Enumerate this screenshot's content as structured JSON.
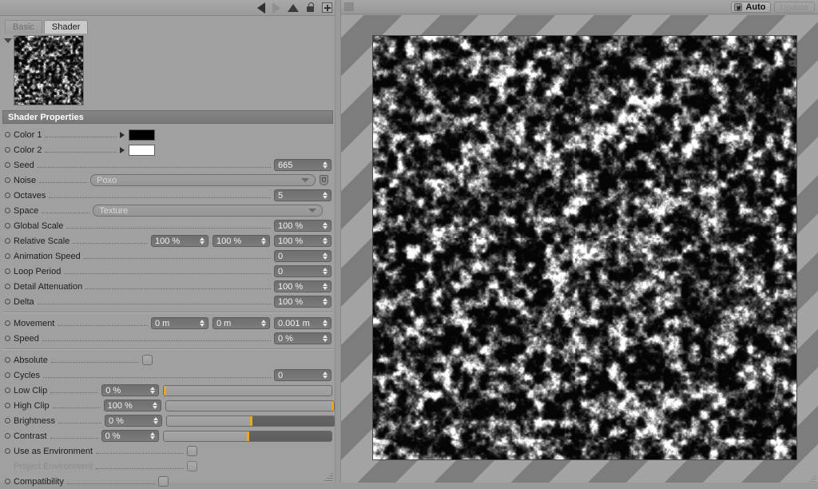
{
  "left_panel": {
    "toolbar": {
      "back_icon": "triangle-left-icon",
      "forward_icon": "triangle-right-icon",
      "up_icon": "triangle-up-icon",
      "lock_icon": "lock-open-icon",
      "add_icon": "plus-icon"
    },
    "tabs": [
      {
        "label": "Basic",
        "active": false
      },
      {
        "label": "Shader",
        "active": true
      }
    ],
    "preview": {
      "disclosure_icon": "triangle-down-icon",
      "thumbnail_name": "shader-preview-thumbnail"
    },
    "section_title": "Shader Properties",
    "groups": [
      {
        "rows": [
          {
            "label": "Color 1",
            "type": "color",
            "value": "#000000",
            "expand_icon": "triangle-right-icon"
          },
          {
            "label": "Color 2",
            "type": "color",
            "value": "#ffffff",
            "expand_icon": "triangle-right-icon"
          },
          {
            "label": "Seed",
            "type": "number",
            "value": "665"
          },
          {
            "label": "Noise",
            "type": "dropdown",
            "value": "Poxo",
            "badge_icon": "shield-icon"
          },
          {
            "label": "Octaves",
            "type": "number",
            "value": "5"
          },
          {
            "label": "Space",
            "type": "dropdown",
            "value": "Texture"
          },
          {
            "label": "Global Scale",
            "type": "number",
            "value": "100 %"
          },
          {
            "label": "Relative Scale",
            "type": "number3",
            "values": [
              "100 %",
              "100 %",
              "100 %"
            ]
          },
          {
            "label": "Animation Speed",
            "type": "number",
            "value": "0"
          },
          {
            "label": "Loop Period",
            "type": "number",
            "value": "0"
          },
          {
            "label": "Detail Attenuation",
            "type": "number",
            "value": "100 %"
          },
          {
            "label": "Delta",
            "type": "number",
            "value": "100 %"
          }
        ]
      },
      {
        "rows": [
          {
            "label": "Movement",
            "type": "number3",
            "values": [
              "0 m",
              "0 m",
              "0.001 m"
            ]
          },
          {
            "label": "Speed",
            "type": "number",
            "value": "0 %"
          }
        ]
      },
      {
        "rows": [
          {
            "label": "Absolute",
            "type": "checkbox",
            "checked": false
          },
          {
            "label": "Cycles",
            "type": "number",
            "value": "0"
          },
          {
            "label": "Low Clip",
            "type": "slider",
            "value": "0 %",
            "fill_percent": 0,
            "knob_percent": 0
          },
          {
            "label": "High Clip",
            "type": "slider",
            "value": "100 %",
            "fill_percent": 0,
            "knob_percent": 100
          },
          {
            "label": "Brightness",
            "type": "slider",
            "value": "0 %",
            "fill_percent": 50,
            "knob_percent": 50,
            "fill_from": 50
          },
          {
            "label": "Contrast",
            "type": "slider",
            "value": "0 %",
            "fill_percent": 50,
            "knob_percent": 50,
            "fill_from": 50
          },
          {
            "label": "Use as Environment",
            "type": "checkbox",
            "checked": false
          },
          {
            "label": "Project Environment",
            "type": "checkbox",
            "checked": false,
            "disabled": true
          },
          {
            "label": "Compatibility",
            "type": "checkbox",
            "checked": false
          }
        ]
      }
    ]
  },
  "right_panel": {
    "toolbar": {
      "drag_handle_icon": "drag-dots-icon",
      "auto_label": "Auto",
      "auto_checked": true,
      "update_label": "Update",
      "update_disabled": true
    },
    "viewport": {
      "preview_name": "shader-render-preview"
    }
  },
  "colors": {
    "panel_bg": "#a0a0a0",
    "section_header_bg": "#7e7e7e",
    "field_bg": "#727272",
    "slider_knob": "#e8a81f",
    "stripe_light": "#a3a3a3",
    "stripe_dark": "#7d7d7d"
  }
}
